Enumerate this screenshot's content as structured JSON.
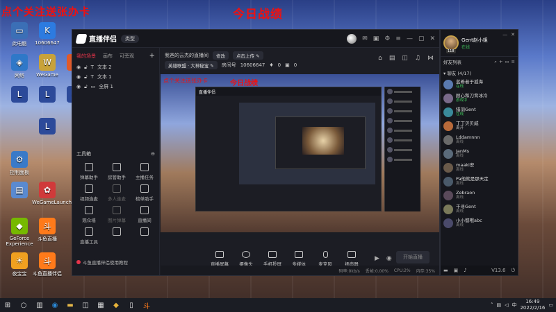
{
  "desktop": {
    "overlay_left": "点个关注送张办卡",
    "overlay_center": "今日战绩",
    "icons": [
      {
        "label": "此电脑",
        "color": "#3b6fb6",
        "glyph": "▭"
      },
      {
        "label": "10606647",
        "color": "#2d7be0",
        "glyph": "K"
      },
      {
        "label": "网络",
        "color": "#2f78c8",
        "glyph": "◈"
      },
      {
        "label": "WeGame",
        "color": "#c8a23a",
        "glyph": "W"
      },
      {
        "label": "",
        "color": "#e05a2a",
        "glyph": "✦"
      },
      {
        "label": "",
        "color": "#2c4a9a",
        "glyph": "L"
      },
      {
        "label": "",
        "color": "#2c4a9a",
        "glyph": "L"
      },
      {
        "label": "",
        "color": "#2c4a9a",
        "glyph": "◎"
      },
      {
        "label": "",
        "color": "#2c4a9a",
        "glyph": "L"
      },
      {
        "label": "控制面板",
        "color": "#3a7ac8",
        "glyph": "⚙"
      },
      {
        "label": "",
        "color": "#5a8ad0",
        "glyph": "▤"
      },
      {
        "label": "WeGameLauncher",
        "color": "#d03a3a",
        "glyph": "✿"
      },
      {
        "label": "GeForce Experience",
        "color": "#76b900",
        "glyph": "◆"
      },
      {
        "label": "斗鱼直播",
        "color": "#ff7a1a",
        "glyph": "斗"
      },
      {
        "label": "夜宝宝",
        "color": "#f0a020",
        "glyph": "☀"
      },
      {
        "label": "斗鱼直播伴侣",
        "color": "#ff7a1a",
        "glyph": "斗"
      }
    ]
  },
  "app": {
    "name": "直播伴侣",
    "type_badge": "类型",
    "left_tabs": [
      "我的场景",
      "画布",
      "可旁观"
    ],
    "scenes": [
      "文本 2",
      "文本 1",
      "全屏 1"
    ],
    "tools_title": "工具箱",
    "tools": [
      {
        "label": "弹幕助手",
        "enabled": true
      },
      {
        "label": "房管助手",
        "enabled": true
      },
      {
        "label": "主播任务",
        "enabled": true
      },
      {
        "label": "视频连麦",
        "enabled": true
      },
      {
        "label": "多人连麦",
        "enabled": false
      },
      {
        "label": "榜单助手",
        "enabled": true
      },
      {
        "label": "观众墙",
        "enabled": true
      },
      {
        "label": "图片弹幕",
        "enabled": false
      },
      {
        "label": "直播间",
        "enabled": true
      },
      {
        "label": "直播工具",
        "enabled": true
      },
      {
        "label": "",
        "enabled": true
      },
      {
        "label": "",
        "enabled": true
      }
    ],
    "bottom_tip": "斗鱼直播伴侣使用教程",
    "room_title": "我爸的云杰的直播间",
    "edit_label": "修改",
    "upload_label": "点击上传",
    "category_label": "英雄联盟 · 大神秘宝",
    "room_id_label": "房间号",
    "room_id": "10606647",
    "fans_count": "0",
    "gift_count": "0",
    "preview_overlay": "今日战绩",
    "controls": [
      "直播屏幕",
      "摄像头",
      "手机投屏",
      "多媒体",
      "麦克风",
      "扬声器"
    ],
    "start_label": "开始直播",
    "status": [
      "码率:0kb/s",
      "丢帧:0.00%",
      "CPU:2%",
      "内存:35%"
    ]
  },
  "friends": {
    "username": "Gent赵小姐",
    "status": "在线",
    "level": "118",
    "list_title": "好友列表",
    "group": "▾ 聊友 (4/17)",
    "items": [
      {
        "name": "蓝希者于孤海",
        "status": "在线",
        "state": "online",
        "color": "#5a7ab0"
      },
      {
        "name": "顾心和刀背冰冷",
        "status": "游戏中",
        "state": "game",
        "color": "#7a6a8a"
      },
      {
        "name": "猎羽Gent",
        "status": "在线",
        "state": "online",
        "color": "#3a8a9a"
      },
      {
        "name": "丁丁贝贝威",
        "status": "离开",
        "state": "leave",
        "color": "#b86a3a"
      },
      {
        "name": "Lddamnnn",
        "status": "离线",
        "state": "offline",
        "color": "#6a6a6a"
      },
      {
        "name": "JanMs",
        "status": "离线",
        "state": "offline",
        "color": "#5a6a7a"
      },
      {
        "name": "maaki安",
        "status": "离线",
        "state": "offline",
        "color": "#6a5a4a"
      },
      {
        "name": "Pa他就是那天定",
        "status": "离线",
        "state": "offline",
        "color": "#4a5a6a"
      },
      {
        "name": "Zebraon",
        "status": "离线",
        "state": "offline",
        "color": "#5a4a5a"
      },
      {
        "name": "千寻Gent",
        "status": "离线",
        "state": "offline",
        "color": "#7a7a5a"
      },
      {
        "name": "小小都哦abc",
        "status": "离线",
        "state": "offline",
        "color": "#4a4a6a"
      }
    ],
    "version": "V13.6"
  },
  "taskbar": {
    "time": "16:49",
    "date": "2022/2/16"
  }
}
